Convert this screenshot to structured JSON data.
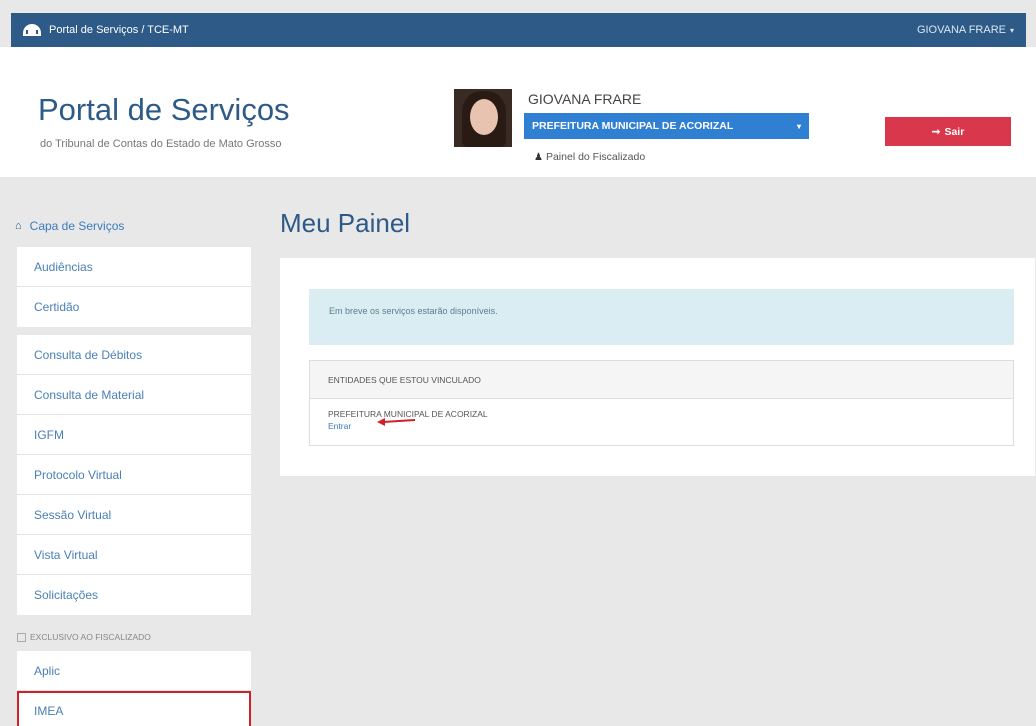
{
  "topbar": {
    "title": "Portal de Serviços / TCE-MT",
    "user": "GIOVANA FRARE",
    "user_caret": "▾"
  },
  "header": {
    "brand_title": "Portal de Serviços",
    "brand_subtitle": "do Tribunal de Contas do Estado de Mato Grosso",
    "user_name": "GIOVANA FRARE",
    "entity_selected": "PREFEITURA MUNICIPAL DE ACORIZAL",
    "painel_link": "Painel do Fiscalizado",
    "sair_label": "Sair"
  },
  "sidebar": {
    "capa": "Capa de Serviços",
    "group1": [
      {
        "label": "Audiências"
      },
      {
        "label": "Certidão"
      }
    ],
    "group2": [
      {
        "label": "Consulta de Débitos"
      },
      {
        "label": "Consulta de Material"
      },
      {
        "label": "IGFM"
      },
      {
        "label": "Protocolo Virtual"
      },
      {
        "label": "Sessão Virtual"
      },
      {
        "label": "Vista Virtual"
      },
      {
        "label": "Solicitações"
      }
    ],
    "exclusive_label": "EXCLUSIVO AO FISCALIZADO",
    "group3": [
      {
        "label": "Aplic"
      },
      {
        "label": "IMEA"
      }
    ]
  },
  "main": {
    "title": "Meu Painel",
    "alert": "Em breve os serviços estarão disponíveis.",
    "entities_header": "ENTIDADES QUE ESTOU VINCULADO",
    "entity_name": "PREFEITURA MUNICIPAL DE ACORIZAL",
    "enter_label": "Entrar"
  },
  "colors": {
    "topbar": "#2d5a87",
    "primary": "#2f7fd3",
    "danger": "#d9374b",
    "highlight": "#d0212a"
  }
}
